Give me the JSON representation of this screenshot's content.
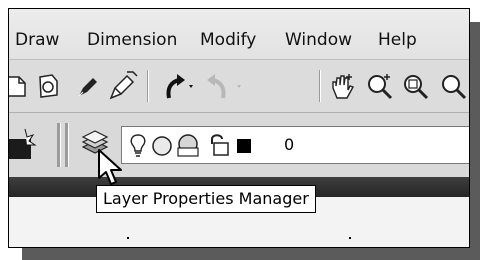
{
  "menu": {
    "items": [
      {
        "label": "Draw"
      },
      {
        "label": "Dimension"
      },
      {
        "label": "Modify"
      },
      {
        "label": "Window"
      },
      {
        "label": "Help"
      }
    ]
  },
  "layer_toolbar": {
    "current_layer_value": "0",
    "tooltip_text": "Layer Properties Manager"
  },
  "icons": [
    "open-file-icon",
    "save-icon",
    "pencil-icon",
    "match-properties-icon",
    "undo-icon",
    "redo-icon",
    "pan-icon",
    "zoom-realtime-icon",
    "zoom-window-icon",
    "layer-properties-icon",
    "lightbulb-icon",
    "freeze-icon",
    "lock-icon",
    "color-swatch-icon",
    "mouse-pointer-icon"
  ],
  "colors": {
    "tooltip_bg": "#ffffff",
    "dark_bar": "#2f2f2f",
    "toolbar_bg": "#d9d9d9"
  }
}
